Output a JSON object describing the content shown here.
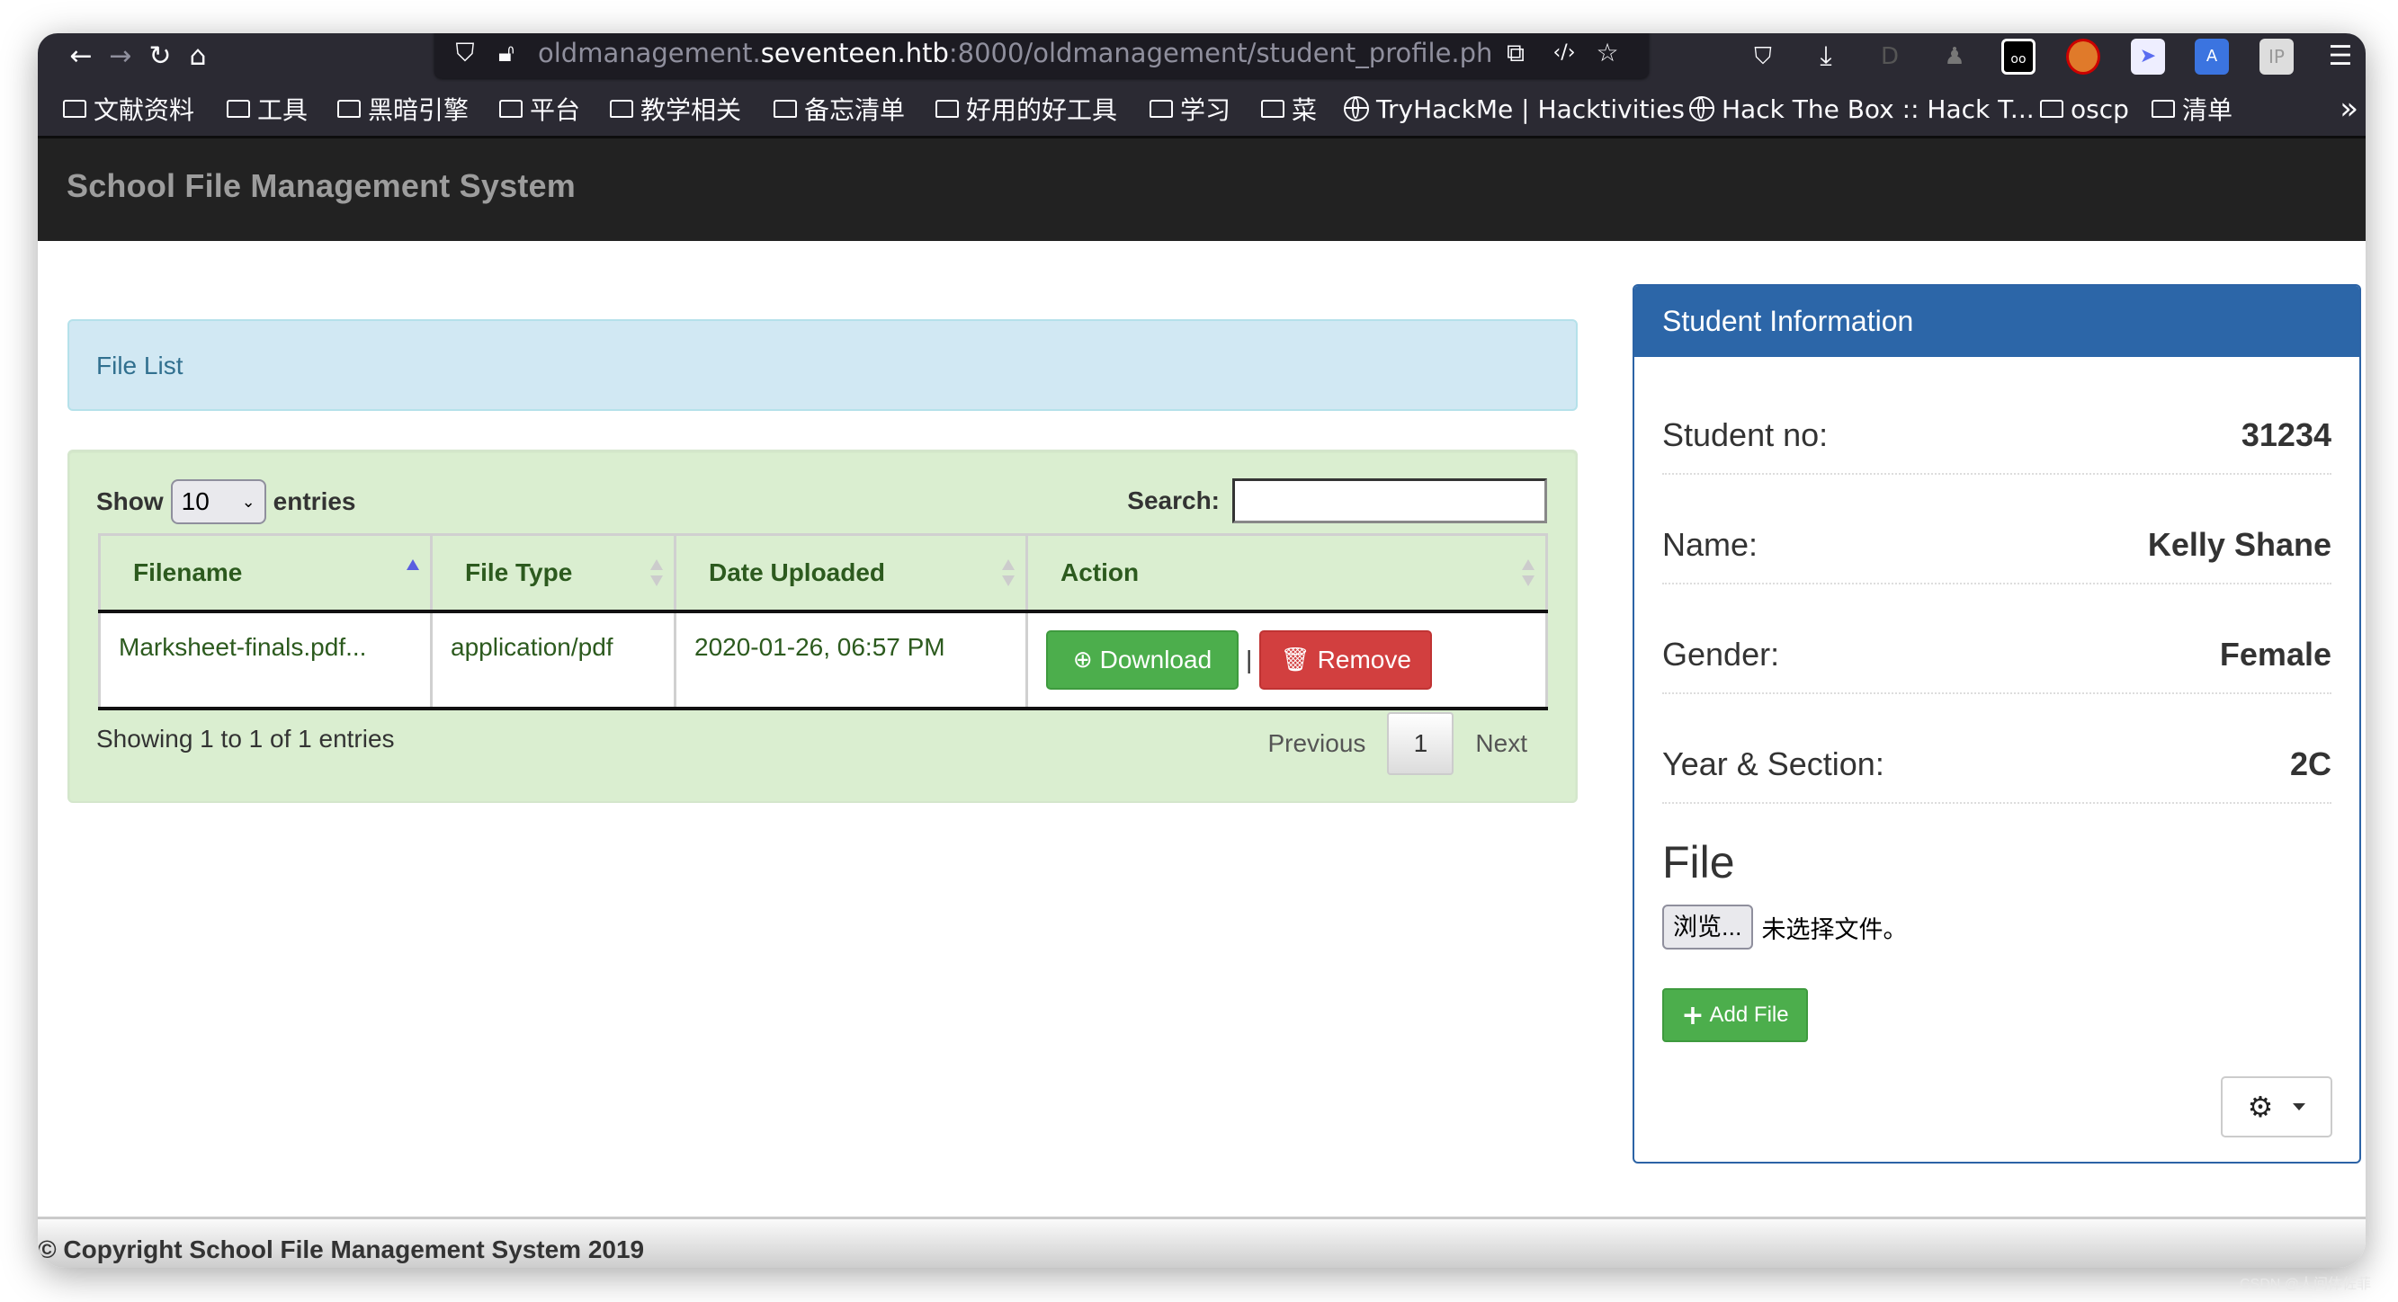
{
  "browser": {
    "url_prefix": "oldmanagement.",
    "url_host": "seventeen.htb",
    "url_rest": ":8000/oldmanagement/student_profile.ph",
    "nav_icons": [
      "back-icon",
      "forward-icon",
      "reload-icon",
      "home-icon"
    ],
    "extension_icons": [
      "pocket-icon",
      "download-icon",
      "dark-reader-icon",
      "spy-extension-icon",
      "cookie-eyes-icon",
      "noscript-icon",
      "shield-ext-icon",
      "translate-icon",
      "ip-icon",
      "menu-icon"
    ],
    "extensions": {
      "ip_label": "IP"
    }
  },
  "bookmarks": [
    {
      "type": "folder",
      "label": "文献资料"
    },
    {
      "type": "folder",
      "label": "工具"
    },
    {
      "type": "folder",
      "label": "黑暗引擎"
    },
    {
      "type": "folder",
      "label": "平台"
    },
    {
      "type": "folder",
      "label": "教学相关"
    },
    {
      "type": "folder",
      "label": "备忘清单"
    },
    {
      "type": "folder",
      "label": "好用的好工具"
    },
    {
      "type": "folder",
      "label": "学习"
    },
    {
      "type": "folder",
      "label": "菜"
    },
    {
      "type": "link",
      "label": "TryHackMe | Hacktivities"
    },
    {
      "type": "link",
      "label": "Hack The Box :: Hack T..."
    },
    {
      "type": "folder",
      "label": "oscp"
    },
    {
      "type": "folder",
      "label": "清单"
    }
  ],
  "bookmarks_overflow": "»",
  "site": {
    "brand": "School File Management System"
  },
  "file_list": {
    "title": "File List",
    "show_label": "Show",
    "entries_label": "entries",
    "page_size": "10",
    "search_label": "Search:",
    "search_value": "",
    "columns": [
      "Filename",
      "File Type",
      "Date Uploaded",
      "Action"
    ],
    "sorted_column": "Filename",
    "sort_direction": "ascending",
    "rows": [
      {
        "filename": "Marksheet-finals.pdf...",
        "file_type": "application/pdf",
        "date_uploaded": "2020-01-26, 06:57 PM",
        "download_label": "Download",
        "separator": "|",
        "remove_label": "Remove"
      }
    ],
    "info": "Showing 1 to 1 of 1 entries",
    "pagination": {
      "previous": "Previous",
      "current_page": "1",
      "next": "Next"
    }
  },
  "student": {
    "panel_title": "Student Information",
    "fields": [
      {
        "label": "Student no:",
        "value": "31234"
      },
      {
        "label": "Name:",
        "value": "Kelly Shane"
      },
      {
        "label": "Gender:",
        "value": "Female"
      },
      {
        "label": "Year & Section:",
        "value": "2C"
      }
    ],
    "file_heading": "File",
    "browse_label": "浏览...",
    "no_file_label": "未选择文件。",
    "add_file_label": "Add File"
  },
  "footer": {
    "copyright": "© Copyright School File Management System 2019"
  },
  "watermark": "CSDN @人间体佐菲"
}
